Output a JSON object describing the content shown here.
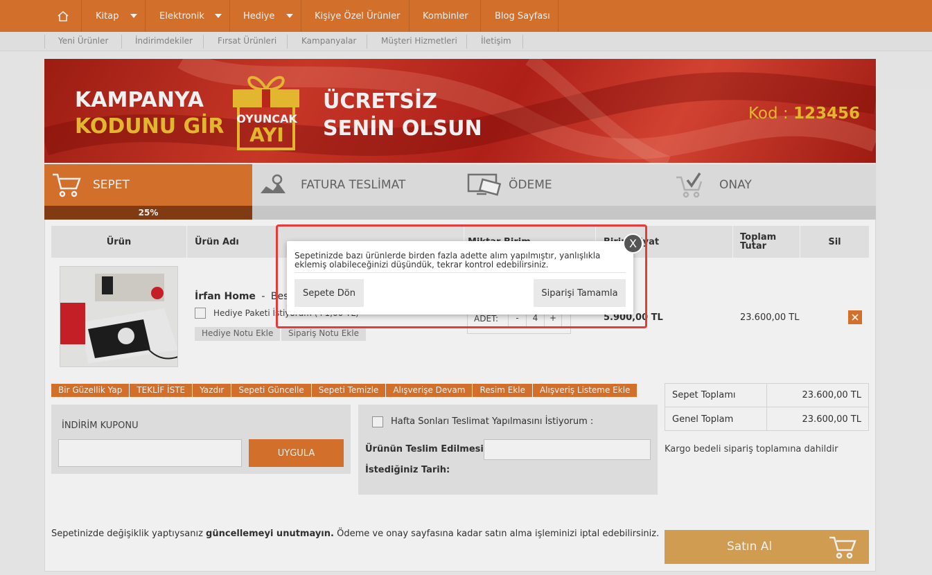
{
  "topnav": {
    "items": [
      {
        "label": "Kitap"
      },
      {
        "label": "Elektronik"
      },
      {
        "label": "Hediye"
      },
      {
        "label": "Kişiye Özel Ürünler"
      },
      {
        "label": "Kombinler"
      },
      {
        "label": "Blog Sayfası"
      }
    ]
  },
  "subnav": {
    "items": [
      "Yeni Ürünler",
      "İndirimdekiler",
      "Fırsat Ürünleri",
      "Kampanyalar",
      "Müşteri Hizmetleri",
      "İletişim"
    ]
  },
  "banner": {
    "line1": "KAMPANYA",
    "line2": "KODUNU GİR",
    "badge1": "OYUNCAK",
    "badge2": "AYI",
    "line3": "ÜCRETSİZ",
    "line4": "SENİN OLSUN",
    "code_label": "Kod :",
    "code": "123456"
  },
  "steps": [
    {
      "label": "SEPET"
    },
    {
      "label": "FATURA TESLİMAT"
    },
    {
      "label": "ÖDEME"
    },
    {
      "label": "ONAY"
    }
  ],
  "progress_text": "25%",
  "progress_value": 0.25,
  "table": {
    "headers": [
      "Ürün",
      "Ürün Adı",
      "Miktar Birim",
      "Birim Fiyat",
      "Toplam Tutar",
      "Sil"
    ],
    "row": {
      "brand": "İrfan Home",
      "name_dash": "-",
      "name": "Besik",
      "gift_pack": "Hediye Paketi İstiyorum (+1,00 TL)",
      "gift_note": "Hediye Notu Ekle",
      "order_note": "Sipariş Notu Ekle",
      "qty_label": "ADET:",
      "minus": "-",
      "qty": "4",
      "plus": "+",
      "unit_price": "5.900,00 TL",
      "total": "23.600,00 TL"
    }
  },
  "actions": [
    "Bir Güzellik Yap",
    "TEKLİF İSTE",
    "Yazdır",
    "Sepeti Güncelle",
    "Sepeti Temizle",
    "Alışverişe Devam",
    "Resim Ekle",
    "Alışveriş Listeme Ekle"
  ],
  "coupon": {
    "label": "İNDİRİM KUPONU",
    "input_value": "",
    "apply": "UYGULA"
  },
  "delivery": {
    "weekend_label": "Hafta Sonları Teslimat Yapılmasını İstiyorum :",
    "date_label_1": "Ürünün Teslim Edilmesini",
    "date_label_2": "İstediğiniz Tarih:",
    "date_value": ""
  },
  "totals": {
    "subtotal_label": "Sepet Toplamı",
    "subtotal_value": "23.600,00 TL",
    "grand_label": "Genel Toplam",
    "grand_value": "23.600,00 TL",
    "shipping_note": "Kargo bedeli sipariş toplamına dahildir"
  },
  "footer_note": {
    "part1": "Sepetinizde değişiklik yaptıysanız ",
    "bold": "güncellemeyi unutmayın.",
    "part2": " Ödeme ve onay sayfasına kadar satın alma işleminizi iptal edebilirsiniz."
  },
  "buy_button": "Satın Al",
  "modal": {
    "message": "Sepetinizde bazı ürünlerde birden fazla adette alım yapılmıştır, yanlışlıkla eklemiş olabileceğinizi düşündük, tekrar kontrol edebilirsiniz.",
    "back_button": "Sepete Dön",
    "complete_button": "Siparişi Tamamla",
    "close": "X"
  },
  "colors": {
    "accent": "#e0782e",
    "accent_dark": "#8a3f14",
    "banner_red": "#c42a1c",
    "gold": "#f2c233",
    "highlight_border": "#e53b3b"
  }
}
